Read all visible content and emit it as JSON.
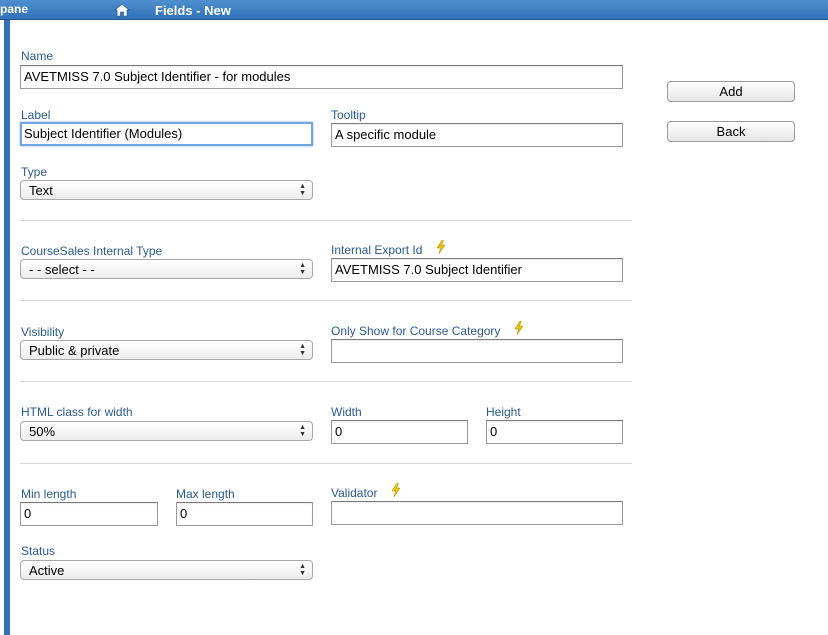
{
  "topbar": {
    "pane_label": "pane",
    "title": "Fields - New"
  },
  "form": {
    "name": {
      "label": "Name",
      "value": "AVETMISS 7.0 Subject Identifier - for modules"
    },
    "label": {
      "label": "Label",
      "value": "Subject Identifier (Modules)"
    },
    "tooltip": {
      "label": "Tooltip",
      "value": "A specific module"
    },
    "type": {
      "label": "Type",
      "value": "Text"
    },
    "internal_type": {
      "label": "CourseSales Internal Type",
      "value": "- - select - -"
    },
    "export_id": {
      "label": "Internal Export Id",
      "value": "AVETMISS 7.0 Subject Identifier"
    },
    "visibility": {
      "label": "Visibility",
      "value": "Public & private"
    },
    "course_category": {
      "label": "Only Show for Course Category",
      "value": ""
    },
    "html_class": {
      "label": "HTML class for width",
      "value": "50%"
    },
    "width": {
      "label": "Width",
      "value": "0"
    },
    "height": {
      "label": "Height",
      "value": "0"
    },
    "min_length": {
      "label": "Min length",
      "value": "0"
    },
    "max_length": {
      "label": "Max length",
      "value": "0"
    },
    "validator": {
      "label": "Validator",
      "value": ""
    },
    "status": {
      "label": "Status",
      "value": "Active"
    }
  },
  "actions": {
    "add": "Add",
    "back": "Back"
  },
  "colors": {
    "topbar": "#2f72b8",
    "label_text": "#2a5a8f",
    "bolt": "#e8c400"
  },
  "icons": {
    "home": "home-icon",
    "bolt": "lightning-bolt-icon"
  }
}
